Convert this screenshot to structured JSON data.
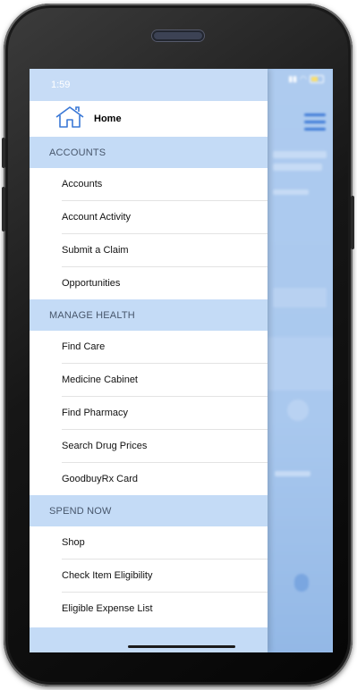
{
  "status_bar": {
    "time": "1:59"
  },
  "drawer": {
    "home_label": "Home",
    "sections": [
      {
        "title": "ACCOUNTS",
        "items": [
          "Accounts",
          "Account Activity",
          "Submit a Claim",
          "Opportunities"
        ]
      },
      {
        "title": "MANAGE HEALTH",
        "items": [
          "Find Care",
          "Medicine Cabinet",
          "Find Pharmacy",
          "Search Drug Prices",
          "GoodbuyRx Card"
        ]
      },
      {
        "title": "SPEND NOW",
        "items": [
          "Shop",
          "Check Item Eligibility",
          "Eligible Expense List"
        ]
      }
    ]
  },
  "icons": {
    "home": "home-icon",
    "menu": "hamburger-menu-icon"
  },
  "colors": {
    "section_bg": "#c4dbf6",
    "accent": "#3a78d6",
    "overlay": "#a9c8ee"
  }
}
